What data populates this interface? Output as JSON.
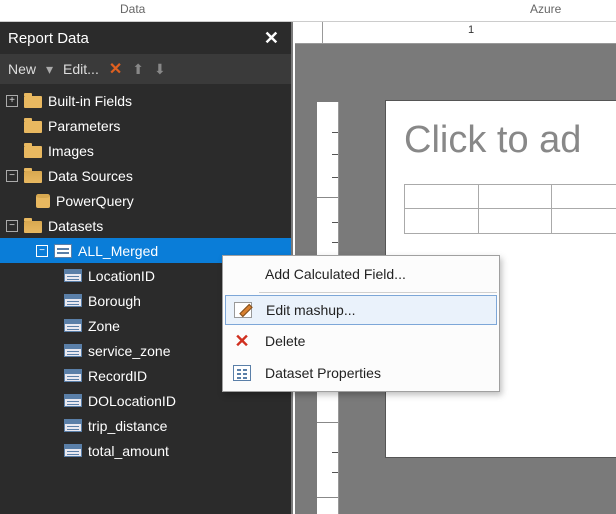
{
  "topTabs": {
    "left": "Data",
    "right": "Azure"
  },
  "panel": {
    "title": "Report Data",
    "toolbar": {
      "newLabel": "New",
      "editLabel": "Edit..."
    }
  },
  "tree": {
    "builtins": "Built-in Fields",
    "parameters": "Parameters",
    "images": "Images",
    "dataSources": "Data Sources",
    "powerQuery": "PowerQuery",
    "datasets": "Datasets",
    "allMerged": "ALL_Merged",
    "fields": [
      "LocationID",
      "Borough",
      "Zone",
      "service_zone",
      "RecordID",
      "DOLocationID",
      "trip_distance",
      "total_amount"
    ]
  },
  "contextMenu": {
    "addCalc": "Add Calculated Field...",
    "editMashup": "Edit mashup...",
    "delete": "Delete",
    "props": "Dataset Properties"
  },
  "design": {
    "titlePlaceholder": "Click to ad",
    "ruler": [
      "1"
    ]
  }
}
